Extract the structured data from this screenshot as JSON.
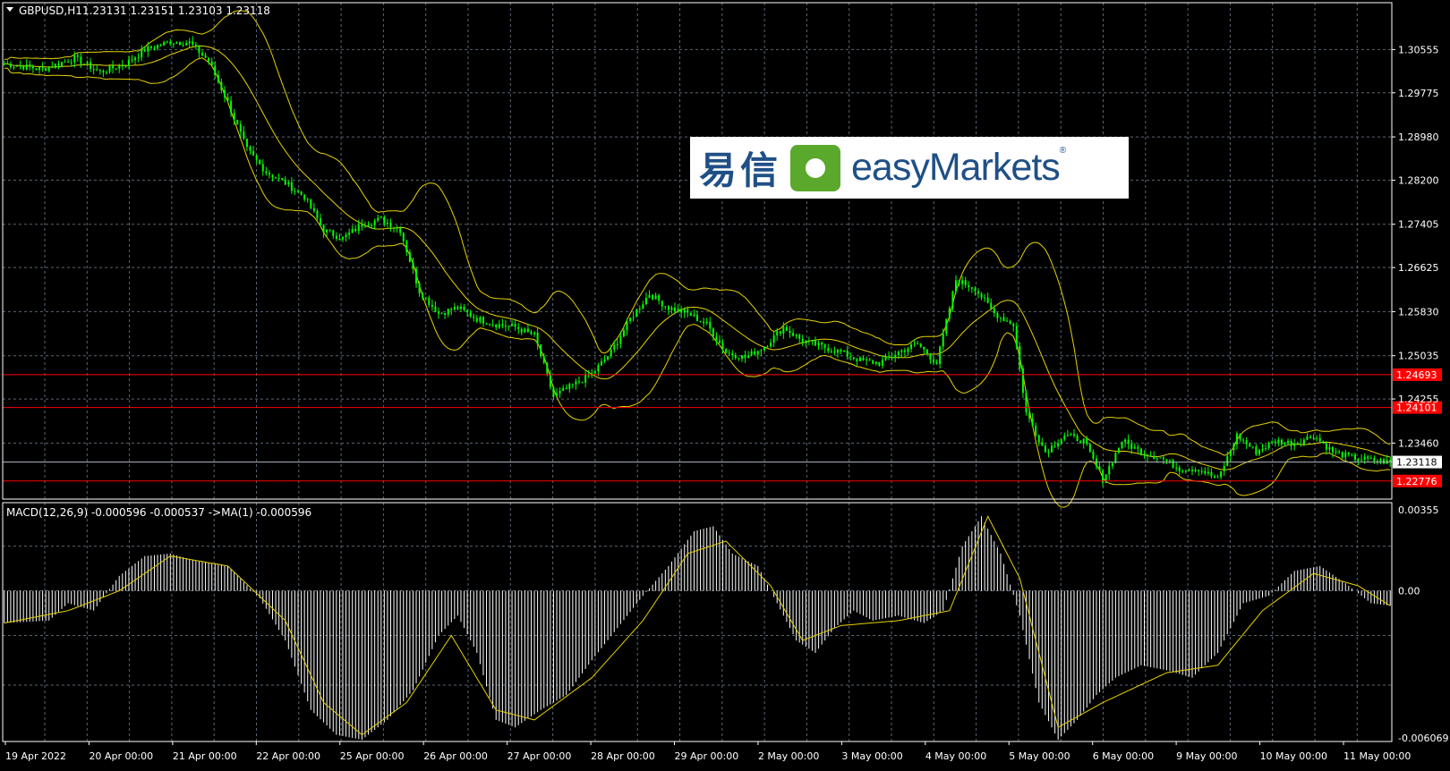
{
  "window": {
    "title": "GBPUSD,H1",
    "ohlc": "1.23131 1.23151 1.23103 1.23118"
  },
  "logo": {
    "cn": "易信",
    "en": "easyMarkets",
    "reg": "®"
  },
  "colors": {
    "background": "#000000",
    "grid": "#5a6573",
    "candle": "#00ff00",
    "bollinger": "#e6d200",
    "level_line": "#ff0000",
    "price_line": "#b0b8c0",
    "macd_hist": "#ffffff",
    "macd_signal": "#e6d200",
    "axis_text": "#ffffff"
  },
  "chart_data": [
    {
      "type": "candlestick",
      "title": "GBPUSD,H1",
      "indicator": "Bollinger Bands",
      "y_ticks": [
        "1.30555",
        "1.29775",
        "1.28980",
        "1.28200",
        "1.27405",
        "1.26625",
        "1.25830",
        "1.25035",
        "1.24255",
        "1.23460"
      ],
      "ylim": [
        1.2245,
        1.314
      ],
      "current_price": {
        "label": "1.23118",
        "value": 1.23118
      },
      "levels": [
        {
          "label": "1.24693",
          "value": 1.24693
        },
        {
          "label": "1.24101",
          "value": 1.24101
        },
        {
          "label": "1.22776",
          "value": 1.22776
        }
      ],
      "x_labels": [
        "19 Apr 2022",
        "20 Apr 00:00",
        "21 Apr 00:00",
        "22 Apr 00:00",
        "25 Apr 00:00",
        "26 Apr 00:00",
        "27 Apr 00:00",
        "28 Apr 00:00",
        "29 Apr 00:00",
        "2 May 00:00",
        "3 May 00:00",
        "4 May 00:00",
        "5 May 00:00",
        "6 May 00:00",
        "9 May 00:00",
        "10 May 00:00",
        "11 May 00:00"
      ],
      "close_path": [
        [
          0,
          1.303
        ],
        [
          12,
          1.302
        ],
        [
          22,
          1.304
        ],
        [
          30,
          1.3015
        ],
        [
          38,
          1.303
        ],
        [
          44,
          1.3055
        ],
        [
          52,
          1.307
        ],
        [
          58,
          1.3068
        ],
        [
          64,
          1.3035
        ],
        [
          70,
          1.296
        ],
        [
          76,
          1.2875
        ],
        [
          82,
          1.2835
        ],
        [
          88,
          1.2815
        ],
        [
          94,
          1.279
        ],
        [
          100,
          1.273
        ],
        [
          106,
          1.2715
        ],
        [
          112,
          1.274
        ],
        [
          118,
          1.275
        ],
        [
          124,
          1.273
        ],
        [
          130,
          1.262
        ],
        [
          136,
          1.258
        ],
        [
          142,
          1.259
        ],
        [
          148,
          1.257
        ],
        [
          154,
          1.256
        ],
        [
          160,
          1.2555
        ],
        [
          166,
          1.254
        ],
        [
          172,
          1.243
        ],
        [
          178,
          1.245
        ],
        [
          184,
          1.247
        ],
        [
          190,
          1.251
        ],
        [
          196,
          1.257
        ],
        [
          202,
          1.2615
        ],
        [
          208,
          1.259
        ],
        [
          214,
          1.258
        ],
        [
          220,
          1.256
        ],
        [
          226,
          1.251
        ],
        [
          232,
          1.25
        ],
        [
          238,
          1.252
        ],
        [
          244,
          1.2555
        ],
        [
          250,
          1.253
        ],
        [
          256,
          1.252
        ],
        [
          262,
          1.251
        ],
        [
          268,
          1.2495
        ],
        [
          274,
          1.249
        ],
        [
          280,
          1.251
        ],
        [
          286,
          1.2525
        ],
        [
          292,
          1.249
        ],
        [
          298,
          1.264
        ],
        [
          304,
          1.2625
        ],
        [
          310,
          1.258
        ],
        [
          316,
          1.256
        ],
        [
          320,
          1.24
        ],
        [
          326,
          1.233
        ],
        [
          332,
          1.236
        ],
        [
          338,
          1.235
        ],
        [
          344,
          1.228
        ],
        [
          350,
          1.235
        ],
        [
          356,
          1.233
        ],
        [
          362,
          1.232
        ],
        [
          368,
          1.23
        ],
        [
          374,
          1.23
        ],
        [
          380,
          1.228
        ],
        [
          386,
          1.236
        ],
        [
          392,
          1.233
        ],
        [
          398,
          1.235
        ],
        [
          404,
          1.2345
        ],
        [
          410,
          1.236
        ],
        [
          416,
          1.233
        ],
        [
          422,
          1.232
        ],
        [
          428,
          1.2315
        ],
        [
          434,
          1.2312
        ]
      ],
      "n_bars": 435
    },
    {
      "type": "bar",
      "title": "MACD(12,26,9) -0.000596 -0.000537  ->MA(1) -0.000596",
      "y_ticks": [
        "0.00355",
        "0.00",
        "-0.006069"
      ],
      "ylim": [
        -0.006069,
        0.00355
      ],
      "hist_path": [
        [
          0,
          -0.0013
        ],
        [
          14,
          -0.0012
        ],
        [
          20,
          -0.0005
        ],
        [
          28,
          -0.0008
        ],
        [
          36,
          0.0006
        ],
        [
          44,
          0.0014
        ],
        [
          52,
          0.0015
        ],
        [
          60,
          0.0012
        ],
        [
          70,
          0.001
        ],
        [
          80,
          -0.0003
        ],
        [
          88,
          -0.002
        ],
        [
          96,
          -0.0048
        ],
        [
          104,
          -0.0058
        ],
        [
          112,
          -0.006
        ],
        [
          120,
          -0.0052
        ],
        [
          128,
          -0.004
        ],
        [
          136,
          -0.0018
        ],
        [
          142,
          -0.001
        ],
        [
          148,
          -0.0025
        ],
        [
          154,
          -0.0052
        ],
        [
          160,
          -0.0055
        ],
        [
          168,
          -0.0048
        ],
        [
          176,
          -0.0042
        ],
        [
          184,
          -0.0028
        ],
        [
          192,
          -0.0015
        ],
        [
          200,
          -0.0002
        ],
        [
          208,
          0.001
        ],
        [
          216,
          0.0024
        ],
        [
          222,
          0.0026
        ],
        [
          228,
          0.0015
        ],
        [
          236,
          0.001
        ],
        [
          242,
          -0.0005
        ],
        [
          248,
          -0.002
        ],
        [
          254,
          -0.0025
        ],
        [
          260,
          -0.0015
        ],
        [
          266,
          -0.0008
        ],
        [
          272,
          -0.0012
        ],
        [
          280,
          -0.001
        ],
        [
          288,
          -0.0013
        ],
        [
          294,
          -0.0008
        ],
        [
          300,
          0.0018
        ],
        [
          306,
          0.003
        ],
        [
          312,
          0.0015
        ],
        [
          318,
          -0.001
        ],
        [
          324,
          -0.0045
        ],
        [
          330,
          -0.006
        ],
        [
          336,
          -0.0052
        ],
        [
          342,
          -0.0042
        ],
        [
          348,
          -0.0035
        ],
        [
          356,
          -0.003
        ],
        [
          364,
          -0.0032
        ],
        [
          372,
          -0.0035
        ],
        [
          380,
          -0.0025
        ],
        [
          388,
          -0.0005
        ],
        [
          396,
          -0.0002
        ],
        [
          404,
          0.0008
        ],
        [
          412,
          0.001
        ],
        [
          420,
          0.0003
        ],
        [
          428,
          -0.0005
        ],
        [
          434,
          -0.0006
        ]
      ],
      "signal_path": [
        [
          0,
          -0.0013
        ],
        [
          20,
          -0.0008
        ],
        [
          36,
          0.0
        ],
        [
          52,
          0.0014
        ],
        [
          70,
          0.001
        ],
        [
          88,
          -0.0012
        ],
        [
          100,
          -0.0045
        ],
        [
          112,
          -0.0058
        ],
        [
          126,
          -0.0045
        ],
        [
          140,
          -0.0018
        ],
        [
          154,
          -0.0048
        ],
        [
          166,
          -0.0052
        ],
        [
          184,
          -0.0035
        ],
        [
          200,
          -0.0012
        ],
        [
          214,
          0.0015
        ],
        [
          226,
          0.002
        ],
        [
          240,
          0.0002
        ],
        [
          250,
          -0.002
        ],
        [
          262,
          -0.0014
        ],
        [
          280,
          -0.0012
        ],
        [
          296,
          -0.0008
        ],
        [
          308,
          0.003
        ],
        [
          318,
          0.0005
        ],
        [
          330,
          -0.0055
        ],
        [
          344,
          -0.0045
        ],
        [
          364,
          -0.0033
        ],
        [
          380,
          -0.003
        ],
        [
          394,
          -0.0008
        ],
        [
          410,
          0.0007
        ],
        [
          424,
          0.0002
        ],
        [
          434,
          -0.0006
        ]
      ],
      "n_bars": 435
    }
  ]
}
